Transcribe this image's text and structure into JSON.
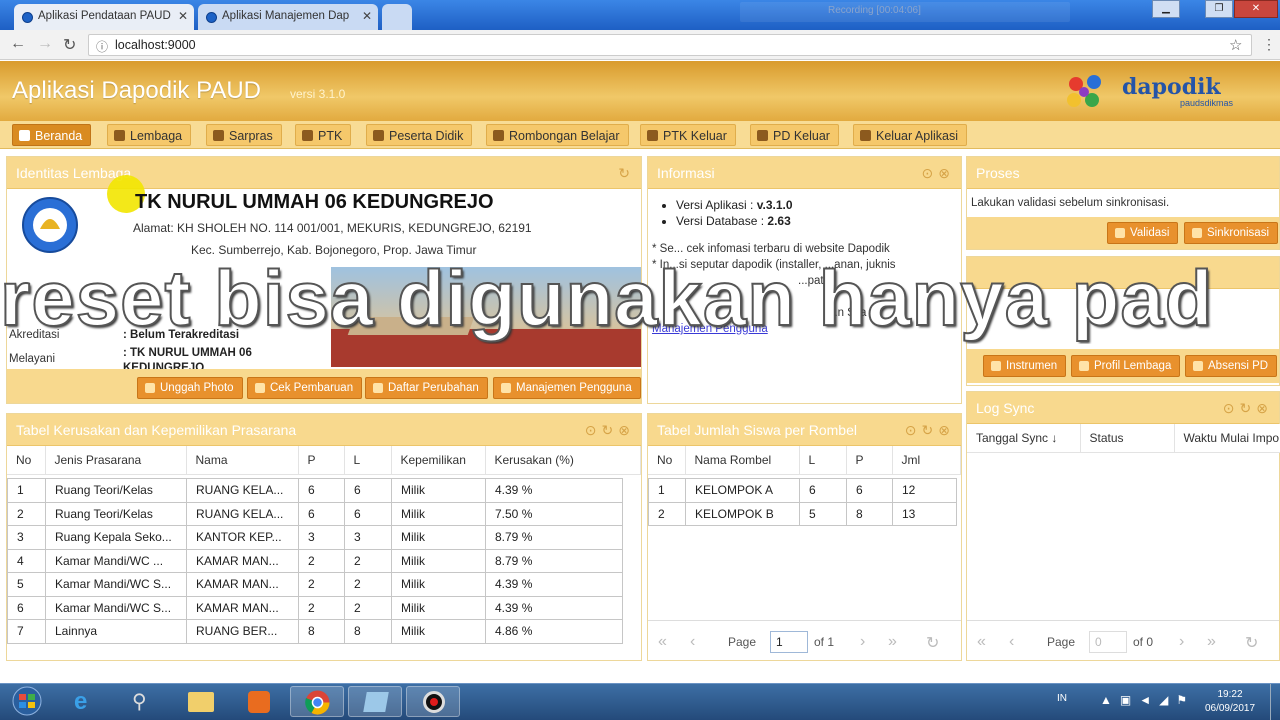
{
  "browser": {
    "tabs": [
      {
        "label": "Aplikasi Pendataan PAUD"
      },
      {
        "label": "Aplikasi Manajemen Dap"
      }
    ],
    "recording_label": "Recording [00:04:06]",
    "url": "localhost:9000"
  },
  "app": {
    "title": "Aplikasi Dapodik PAUD",
    "version": "versi 3.1.0",
    "logo_text": "dapodik",
    "logo_sub": "paudsdikmas"
  },
  "menu": [
    {
      "label": "Beranda",
      "icon": "home-icon"
    },
    {
      "label": "Lembaga",
      "icon": "building-icon"
    },
    {
      "label": "Sarpras",
      "icon": "sarpras-icon"
    },
    {
      "label": "PTK",
      "icon": "ptk-icon"
    },
    {
      "label": "Peserta Didik",
      "icon": "students-icon"
    },
    {
      "label": "Rombongan Belajar",
      "icon": "group-icon"
    },
    {
      "label": "PTK Keluar",
      "icon": "ptk-exit-icon"
    },
    {
      "label": "PD Keluar",
      "icon": "pd-exit-icon"
    },
    {
      "label": "Keluar Aplikasi",
      "icon": "exit-icon"
    }
  ],
  "identitas": {
    "title": "Identitas Lembaga",
    "school_name": "TK NURUL UMMAH 06 KEDUNGREJO",
    "address": "Alamat: KH SHOLEH NO. 114 001/001, MEKURIS, KEDUNGREJO, 62191",
    "address2": "Kec. Sumberrejo, Kab. Bojonegoro, Prop. Jawa Timur",
    "akreditasi_label": "Akreditasi",
    "akreditasi_value": ": Belum Terakreditasi",
    "melayani_label": "Melayani",
    "melayani_value": ": TK NURUL UMMAH 06 KEDUNGREJO",
    "buttons": [
      "Unggah Photo",
      "Cek Pembaruan",
      "Daftar Perubahan",
      "Manajemen Pengguna"
    ]
  },
  "informasi": {
    "title": "Informasi",
    "items": [
      {
        "label": "Versi Aplikasi : ",
        "value": "v.3.1.0"
      },
      {
        "label": "Versi Database : ",
        "value": "2.63"
      }
    ],
    "note1": "* Se... cek infomasi terbaru di website Dapodik",
    "link1": "website",
    "note2": "* In...si seputar dapodik (installer, ...anan, juknis",
    "note3": "...pat d",
    "note4": "...n Sila",
    "link2": "Manajemen Pengguna"
  },
  "proses": {
    "title": "Proses",
    "text": "Lakukan validasi sebelum sinkronisasi.",
    "buttons": [
      "Validasi",
      "Sinkronisasi"
    ],
    "buttons2": [
      "Instrumen",
      "Profil Lembaga",
      "Absensi PD"
    ]
  },
  "subtitle": "reset bisa digunakan hanya pad",
  "kerusakan": {
    "title": "Tabel Kerusakan dan Kepemilikan Prasarana",
    "headers": [
      "No",
      "Jenis Prasarana",
      "Nama",
      "P",
      "L",
      "Kepemilikan",
      "Kerusakan (%)"
    ],
    "rows": [
      [
        "1",
        "Ruang Teori/Kelas",
        "RUANG KELA...",
        "6",
        "6",
        "Milik",
        "4.39 %"
      ],
      [
        "2",
        "Ruang Teori/Kelas",
        "RUANG KELA...",
        "6",
        "6",
        "Milik",
        "7.50 %"
      ],
      [
        "3",
        "Ruang Kepala Seko...",
        "KANTOR KEP...",
        "3",
        "3",
        "Milik",
        "8.79 %"
      ],
      [
        "4",
        "Kamar Mandi/WC ...",
        "KAMAR MAN...",
        "2",
        "2",
        "Milik",
        "8.79 %"
      ],
      [
        "5",
        "Kamar Mandi/WC S...",
        "KAMAR MAN...",
        "2",
        "2",
        "Milik",
        "4.39 %"
      ],
      [
        "6",
        "Kamar Mandi/WC S...",
        "KAMAR MAN...",
        "2",
        "2",
        "Milik",
        "4.39 %"
      ],
      [
        "7",
        "Lainnya",
        "RUANG BER...",
        "8",
        "8",
        "Milik",
        "4.86 %"
      ]
    ]
  },
  "rombel": {
    "title": "Tabel Jumlah Siswa per Rombel",
    "headers": [
      "No",
      "Nama Rombel",
      "L",
      "P",
      "Jml"
    ],
    "rows": [
      [
        "1",
        "KELOMPOK A",
        "6",
        "6",
        "12"
      ],
      [
        "2",
        "KELOMPOK B",
        "5",
        "8",
        "13"
      ]
    ],
    "pager": {
      "page_label": "Page",
      "page_value": "1",
      "of_label": "of 1"
    }
  },
  "logsync": {
    "title": "Log Sync",
    "headers": [
      "Tanggal Sync",
      "Status",
      "Waktu Mulai Impo"
    ],
    "pager": {
      "page_label": "Page",
      "page_value": "0",
      "of_label": "of 0"
    }
  },
  "taskbar": {
    "lang": "IN",
    "time": "19:22",
    "date": "06/09/2017"
  },
  "colors": {
    "header": "#e2aa3f",
    "panel_head": "#f8d98e",
    "button": "#e8912d",
    "taskbar": "#2f5a8e"
  }
}
